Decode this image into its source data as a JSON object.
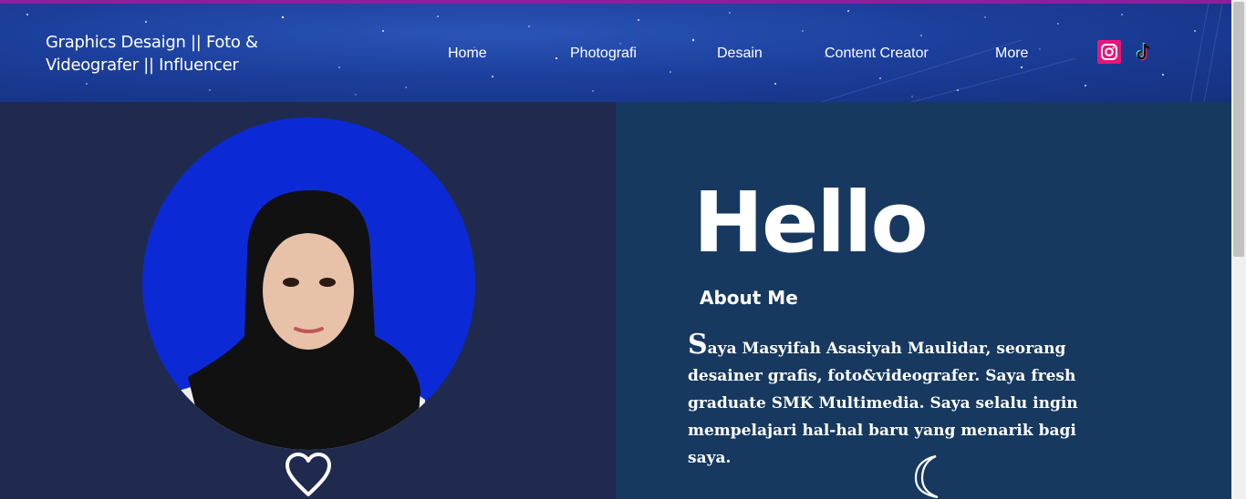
{
  "header": {
    "brand_line1": "Graphics Desaign || Foto &",
    "brand_line2": "Videografer || Influencer",
    "nav": [
      {
        "label": "Home"
      },
      {
        "label": "Photografi"
      },
      {
        "label": "Desain"
      },
      {
        "label": "Content Creator"
      },
      {
        "label": "More"
      }
    ],
    "social": [
      {
        "icon": "instagram-icon",
        "color": "#e4177c"
      },
      {
        "icon": "tiktok-icon",
        "color": "#000000"
      }
    ]
  },
  "hero": {
    "heading": "Hello",
    "subheading": "About Me",
    "bio_initial": "S",
    "bio_text": "aya Masyifah Asasiyah Maulidar, seorang desainer grafis, foto&videografer. Saya fresh graduate SMK Multimedia. Saya selalu ingin mempelajari hal-hal baru yang menarik bagi saya."
  },
  "colors": {
    "accent_top": "#8e1f9c",
    "left_panel": "#202a4e",
    "right_panel": "#17395f",
    "avatar_bg": "#0b2ad6"
  },
  "icons": {
    "left_decoration": "heart-icon",
    "right_decoration": "crescent-moon-icon"
  }
}
